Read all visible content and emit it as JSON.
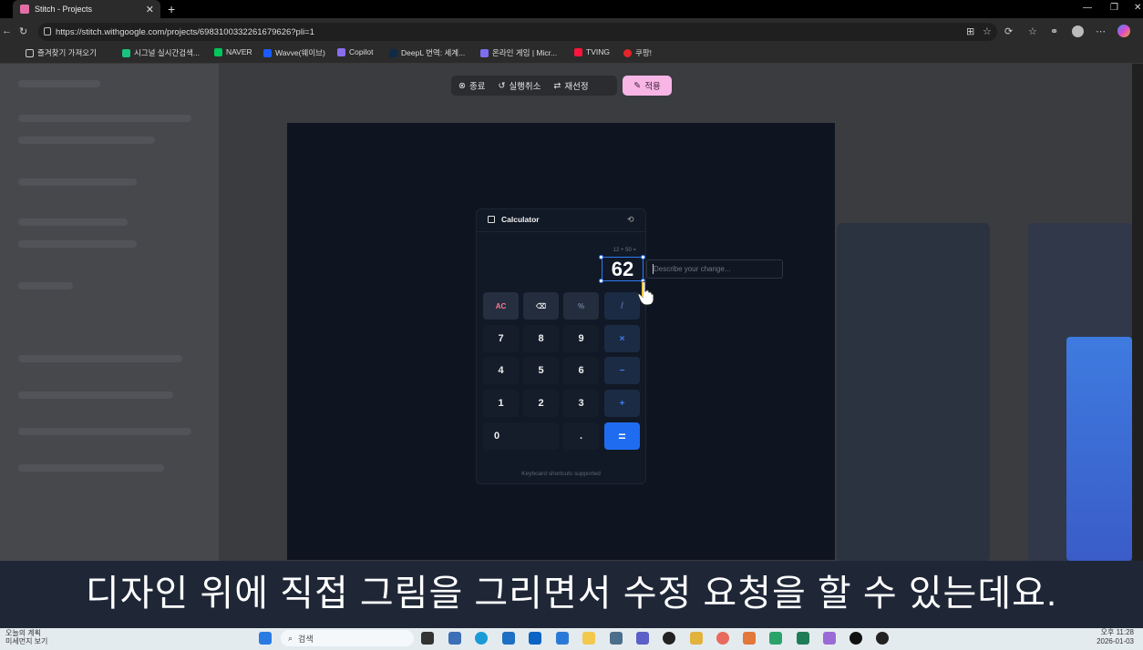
{
  "browser": {
    "tab_title": "Stitch - Projects",
    "new_tab_symbol": "+",
    "url": "https://stitch.withgoogle.com/projects/6983100332261679626?pli=1",
    "bookmarks": [
      {
        "label": "즐겨찾기 가져오기",
        "color": "#cccccc"
      },
      {
        "label": "시그널 실시간검색...",
        "color": "#19c37d"
      },
      {
        "label": "NAVER",
        "color": "#03c75a"
      },
      {
        "label": "Wavve(웨이브)",
        "color": "#1a5cff"
      },
      {
        "label": "Copilot",
        "color": "#8a6cf0"
      },
      {
        "label": "DeepL 번역: 세계...",
        "color": "#0f2b46"
      },
      {
        "label": "온라인 게임 | Micr...",
        "color": "#7b6ff0"
      },
      {
        "label": "TVING",
        "color": "#ff153c"
      },
      {
        "label": "쿠팡!",
        "color": "#e52528"
      }
    ]
  },
  "toolbar": {
    "close_label": "종료",
    "undo_label": "실행취소",
    "reselect_label": "재선정",
    "apply_label": "적용"
  },
  "calculator": {
    "title": "Calculator",
    "expression": "12 + 50 =",
    "result": "62",
    "describe_placeholder": "Describe your change...",
    "keys": {
      "ac": "AC",
      "backspace": "⌫",
      "percent": "%",
      "divide": "/",
      "multiply": "×",
      "minus": "−",
      "plus": "+",
      "equals": "=",
      "dot": ".",
      "digits": [
        "0",
        "1",
        "2",
        "3",
        "4",
        "5",
        "6",
        "7",
        "8",
        "9"
      ]
    },
    "footer": "Keyboard shortcuts supported"
  },
  "subtitle": "디자인 위에 직접 그림을 그리면서 수정 요청을 할 수 있는데요.",
  "taskbar": {
    "search_label": "검색",
    "weather_line1": "오늘의 계획",
    "weather_line2": "미세먼지 보기",
    "time": "오후 11:28",
    "date": "2026-01-03"
  },
  "colors": {
    "accent_blue": "#1f6cf0",
    "apply_pink": "#f7b6e6",
    "artboard": "#0f1520"
  }
}
